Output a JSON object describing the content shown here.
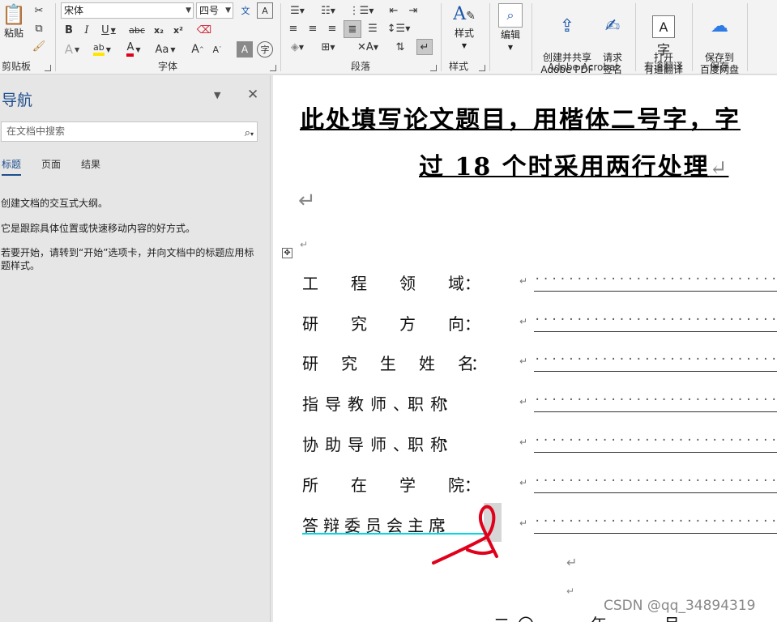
{
  "ribbon": {
    "clipboard": {
      "paste_label": "粘贴",
      "group_label": "剪贴板"
    },
    "font": {
      "font_name": "宋体",
      "font_size": "四号",
      "bold": "B",
      "italic": "I",
      "underline": "U",
      "strike": "abc",
      "subscript": "x₂",
      "superscript": "x²",
      "grow": "A",
      "shrink": "A",
      "case": "Aa",
      "group_label": "字体"
    },
    "paragraph": {
      "group_label": "段落"
    },
    "styles": {
      "styles_label": "样式",
      "group_label": "样式"
    },
    "editing": {
      "label": "编辑"
    },
    "acrobat": {
      "create_pdf": "创建并共享\nAdobe PDF",
      "request_sign": "请求\n签名",
      "group_label": "Adobe Acrobat"
    },
    "youdao": {
      "open": "打开\n有道翻译",
      "group_label": "有道翻译"
    },
    "baidu": {
      "save_to": "保存到\n百度网盘",
      "group_label": "保存"
    }
  },
  "nav": {
    "title": "导航",
    "search_placeholder": "在文档中搜索",
    "tabs": [
      {
        "label": "标题"
      },
      {
        "label": "页面"
      },
      {
        "label": "结果"
      }
    ],
    "messages": [
      "创建文档的交互式大纲。",
      "它是跟踪具体位置或快速移动内容的好方式。",
      "若要开始，请转到“开始”选项卡，并向文档中的标题应用标题样式。"
    ]
  },
  "document": {
    "title_line1": "此处填写论文题目，用楷体二号字，字",
    "title_line2": "过 18 个时采用两行处理",
    "fields": [
      {
        "label": "工　　程　　领　　域："
      },
      {
        "label": "研　　究　　方　　向："
      },
      {
        "label": "研　　究　　生　　姓　　名："
      },
      {
        "label": "指　导　教　师　、　职　称："
      },
      {
        "label": "协　助　导　师　、　职　称："
      },
      {
        "label": "所　　在　　学　　院："
      },
      {
        "label": "答　辩　委　员　会　主　席："
      }
    ],
    "dot_fill": "··································",
    "date_partial": "二〇　　年　　月",
    "pilcrow": "↵"
  },
  "watermark": "CSDN @qq_34894319",
  "colors": {
    "nav_title": "#1e4e8c",
    "annotation_red": "#e0001b",
    "highlight_cyan": "#00d8e8"
  }
}
